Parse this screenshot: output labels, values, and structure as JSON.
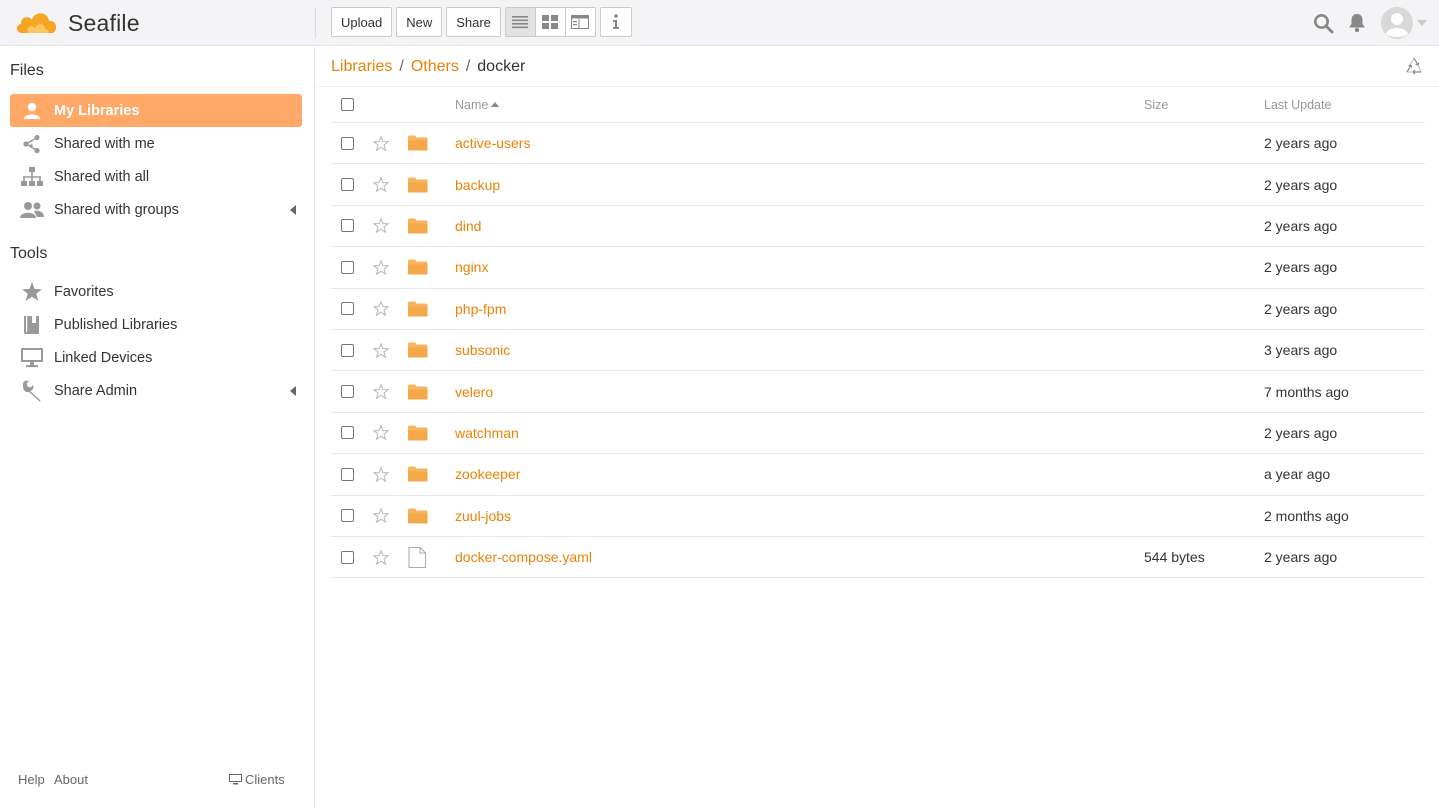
{
  "header": {
    "app_name": "Seafile",
    "toolbar": {
      "upload": "Upload",
      "new": "New",
      "share": "Share"
    },
    "view_modes": [
      "list-view-icon",
      "grid-view-icon",
      "column-view-icon"
    ],
    "active_view": "list-view-icon"
  },
  "sidebar": {
    "files_heading": "Files",
    "files_items": [
      {
        "label": "My Libraries",
        "icon": "user-icon",
        "active": true
      },
      {
        "label": "Shared with me",
        "icon": "share-icon"
      },
      {
        "label": "Shared with all",
        "icon": "org-chart-icon"
      },
      {
        "label": "Shared with groups",
        "icon": "group-icon",
        "expandable": true
      }
    ],
    "tools_heading": "Tools",
    "tools_items": [
      {
        "label": "Favorites",
        "icon": "star-icon"
      },
      {
        "label": "Published Libraries",
        "icon": "book-icon"
      },
      {
        "label": "Linked Devices",
        "icon": "monitor-icon"
      },
      {
        "label": "Share Admin",
        "icon": "wrench-icon",
        "expandable": true
      }
    ],
    "footer": {
      "help": "Help",
      "about": "About",
      "clients": "Clients"
    }
  },
  "breadcrumb": {
    "items": [
      "Libraries",
      "Others"
    ],
    "separator": "/",
    "current": "docker"
  },
  "table": {
    "columns": {
      "name": "Name",
      "size": "Size",
      "last_update": "Last Update"
    },
    "rows": [
      {
        "name": "active-users",
        "type": "folder",
        "size": "",
        "updated": "2 years ago"
      },
      {
        "name": "backup",
        "type": "folder",
        "size": "",
        "updated": "2 years ago"
      },
      {
        "name": "dind",
        "type": "folder",
        "size": "",
        "updated": "2 years ago"
      },
      {
        "name": "nginx",
        "type": "folder",
        "size": "",
        "updated": "2 years ago"
      },
      {
        "name": "php-fpm",
        "type": "folder",
        "size": "",
        "updated": "2 years ago"
      },
      {
        "name": "subsonic",
        "type": "folder",
        "size": "",
        "updated": "3 years ago"
      },
      {
        "name": "velero",
        "type": "folder",
        "size": "",
        "updated": "7 months ago"
      },
      {
        "name": "watchman",
        "type": "folder",
        "size": "",
        "updated": "2 years ago"
      },
      {
        "name": "zookeeper",
        "type": "folder",
        "size": "",
        "updated": "a year ago"
      },
      {
        "name": "zuul-jobs",
        "type": "folder",
        "size": "",
        "updated": "2 months ago"
      },
      {
        "name": "docker-compose.yaml",
        "type": "file",
        "size": "544 bytes",
        "updated": "2 years ago"
      }
    ]
  },
  "colors": {
    "accent": "#eb8205",
    "active_nav": "#ffa868",
    "folder": "#f5a849"
  }
}
